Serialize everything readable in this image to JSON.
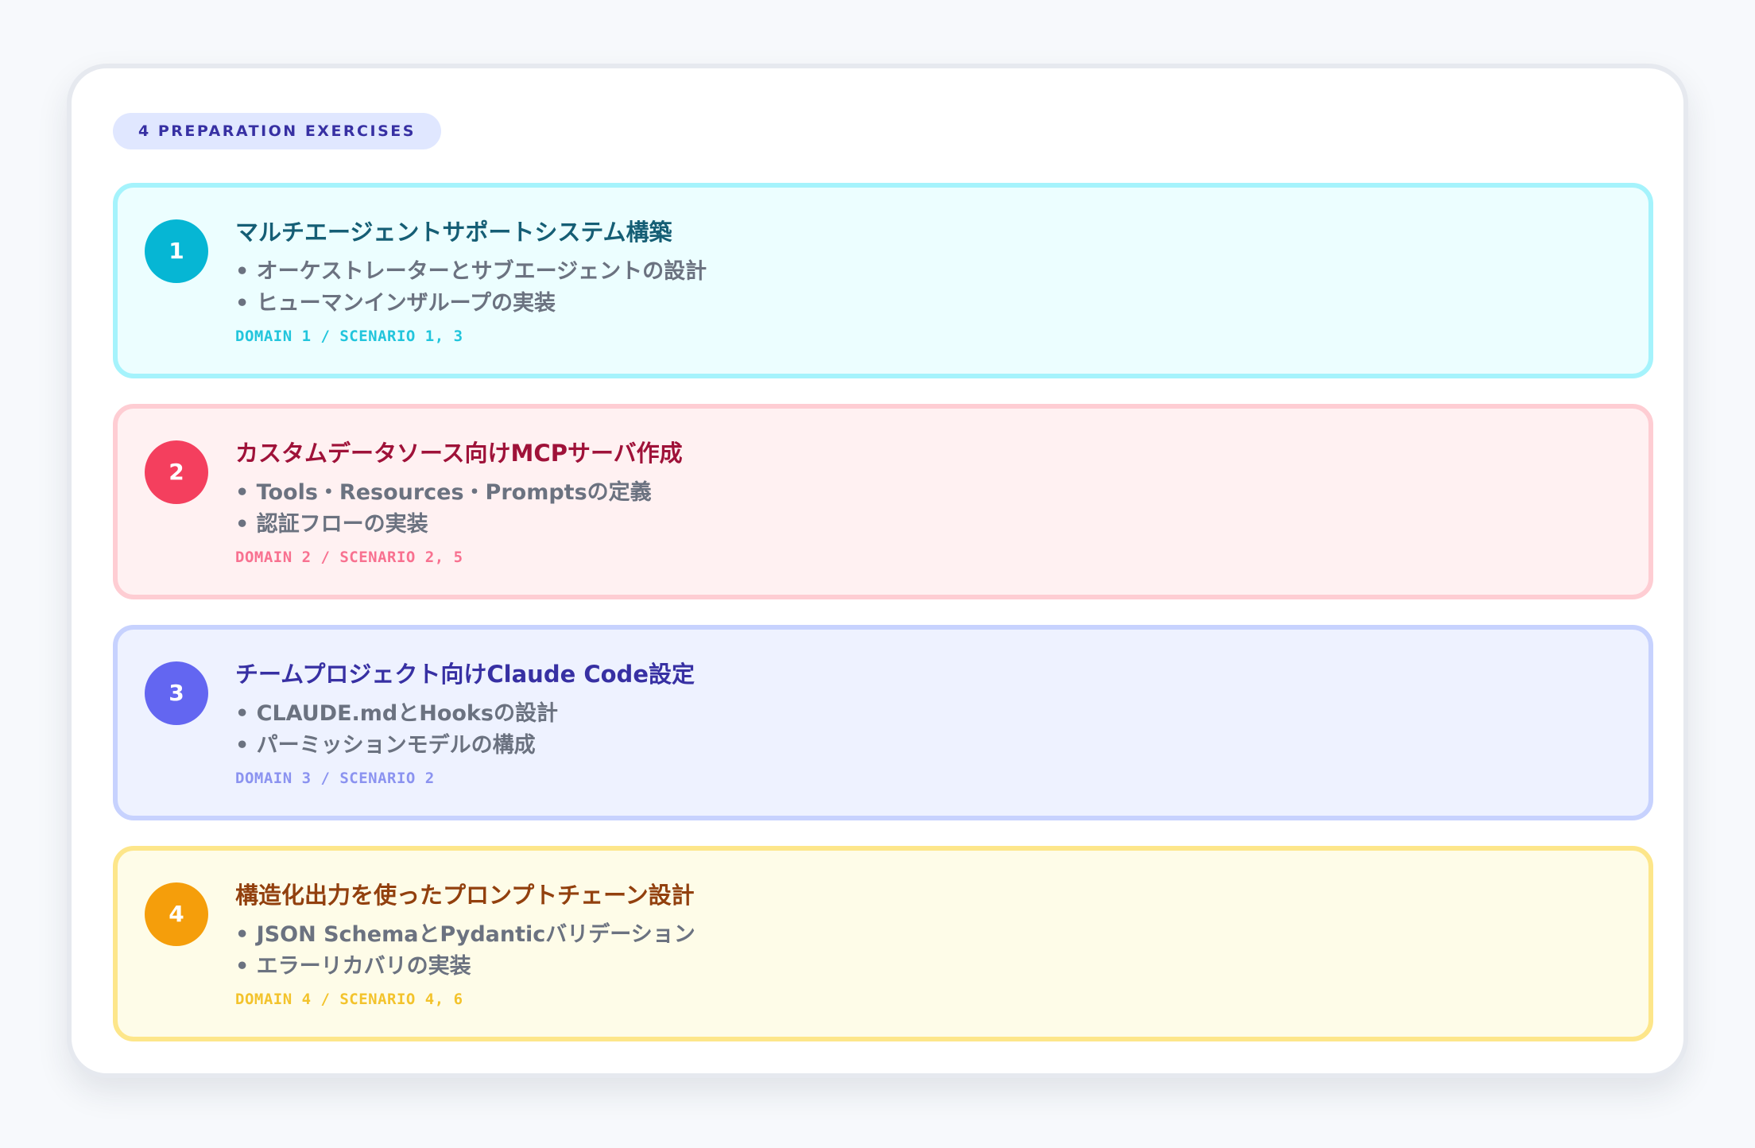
{
  "header": {
    "label": "4 PREPARATION EXERCISES"
  },
  "exercises": [
    {
      "number": "1",
      "title": "マルチエージェントサポートシステム構築",
      "bullets": [
        "• オーケストレーターとサブエージェントの設計",
        "• ヒューマンインザループの実装"
      ],
      "meta": "DOMAIN 1 / SCENARIO 1, 3",
      "theme": "cyan",
      "colors": {
        "badge": "#06b6d4",
        "title": "#155e75",
        "background": "#ecfeff",
        "border": "#a5f3fc"
      }
    },
    {
      "number": "2",
      "title": "カスタムデータソース向けMCPサーバ作成",
      "bullets": [
        "• Tools・Resources・Promptsの定義",
        "• 認証フローの実装"
      ],
      "meta": "DOMAIN 2 / SCENARIO 2, 5",
      "theme": "rose",
      "colors": {
        "badge": "#f43f5e",
        "title": "#9f1239",
        "background": "#fff1f2",
        "border": "#fecdd3"
      }
    },
    {
      "number": "3",
      "title": "チームプロジェクト向けClaude Code設定",
      "bullets": [
        "• CLAUDE.mdとHooksの設計",
        "• パーミッションモデルの構成"
      ],
      "meta": "DOMAIN 3 / SCENARIO 2",
      "theme": "indigo",
      "colors": {
        "badge": "#6366f1",
        "title": "#3730a3",
        "background": "#eef2ff",
        "border": "#c7d2fe"
      }
    },
    {
      "number": "4",
      "title": "構造化出力を使ったプロンプトチェーン設計",
      "bullets": [
        "• JSON SchemaとPydanticバリデーション",
        "• エラーリカバリの実装"
      ],
      "meta": "DOMAIN 4 / SCENARIO 4, 6",
      "theme": "amber",
      "colors": {
        "badge": "#f59e0b",
        "title": "#92400e",
        "background": "#fefce8",
        "border": "#fde68a"
      }
    }
  ]
}
